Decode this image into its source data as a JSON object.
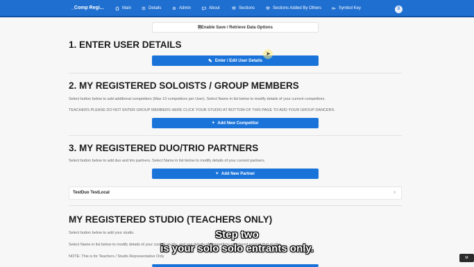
{
  "nav": {
    "brand": "_Comp Regi...",
    "items": [
      {
        "label": "Main",
        "icon": "home-icon"
      },
      {
        "label": "Details",
        "icon": "list-icon"
      },
      {
        "label": "Admin",
        "icon": "gear-icon"
      },
      {
        "label": "About",
        "icon": "chat-icon"
      },
      {
        "label": "Sections",
        "icon": "layers-icon"
      },
      {
        "label": "Sections Added By Others",
        "icon": "layers-icon"
      },
      {
        "label": "Symbol Key",
        "icon": "key-icon"
      }
    ],
    "avatar": "B"
  },
  "save_options": {
    "label": "Enable Save / Retrieve Data Options"
  },
  "section1": {
    "title": "1. ENTER USER DETAILS",
    "button": "Enter / Edit User Details"
  },
  "section2": {
    "title": "2. MY REGISTERED SOLOISTS / GROUP MEMBERS",
    "note1": "Select button below to add additional competitors (Max 10 competitors per User).  Select Name in list below to modify details of your current competitors.",
    "note2": "TEACHERS PLEASE DO NOT ENTER GROUP MEMBERS HERE CLICK YOUR STUDIO AT BOTTOM OF THIS PAGE TO ADD YOUR GROUP DANCERS.",
    "button": "Add New Competitor"
  },
  "section3": {
    "title": "3. MY REGISTERED DUO/TRIO PARTNERS",
    "note": "Select button below to add duo and trio partners.  Select Name in list below to modify details of your current partners.",
    "button": "Add New Partner",
    "partners": [
      "TestDuo TestLocal"
    ]
  },
  "section4": {
    "title": "MY REGISTERED STUDIO (TEACHERS ONLY)",
    "note1": "Select button below to add your studio.",
    "note2": "Select Name in list below to modify details of your current studio, and see details of competitors registered against that studio.",
    "note3": "NOTE: This is for Teachers / Studio Representative Only"
  },
  "captions": {
    "line1": "Step two",
    "line2": "is your solo solo entrants only."
  },
  "corner_label": "M",
  "colors": {
    "nav": "#1f6fd1",
    "button": "#1a73d9",
    "background": "#f7f7f7"
  }
}
